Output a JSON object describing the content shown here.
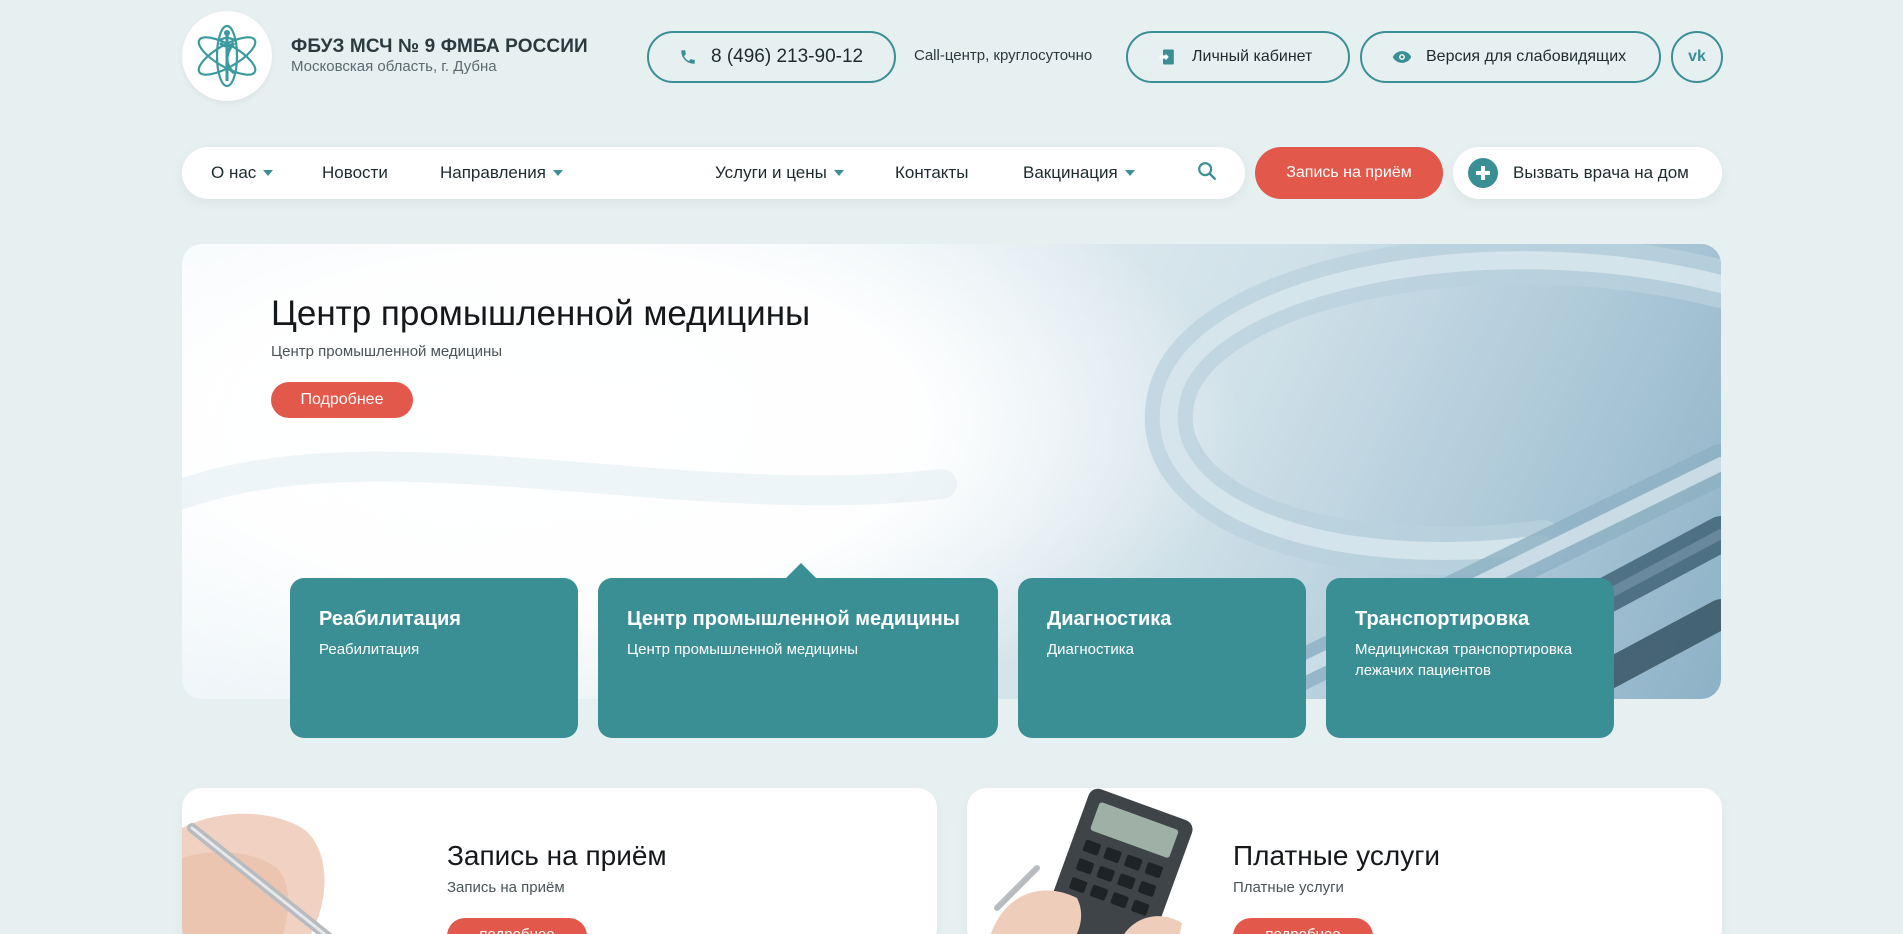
{
  "header": {
    "org_name": "ФБУЗ МСЧ № 9 ФМБА РОССИИ",
    "org_location": "Московская область, г. Дубна",
    "phone": "8 (496) 213-90-12",
    "call_center": "Call-центр, круглосуточно",
    "cabinet_label": "Личный кабинет",
    "vision_label": "Версия для слабовидящих",
    "vk_label": "vk"
  },
  "nav": {
    "items": [
      {
        "label": "О нас",
        "dropdown": true
      },
      {
        "label": "Новости",
        "dropdown": false
      },
      {
        "label": "Направления",
        "dropdown": true
      },
      {
        "label": "Услуги и цены",
        "dropdown": true
      },
      {
        "label": "Контакты",
        "dropdown": false
      },
      {
        "label": "Вакцинация",
        "dropdown": true
      }
    ],
    "appointment_label": "Запись на приём",
    "doctor_home_label": "Вызвать врача на дом"
  },
  "hero": {
    "title": "Центр промышленной медицины",
    "subtitle": "Центр промышленной медицины",
    "more_label": "Подробнее",
    "cards": [
      {
        "title": "Реабилитация",
        "subtitle": "Реабилитация"
      },
      {
        "title": "Центр промышленной медицины",
        "subtitle": "Центр промышленной медицины"
      },
      {
        "title": "Диагностика",
        "subtitle": "Диагностика"
      },
      {
        "title": "Транспортировка",
        "subtitle": "Медицинская транспортировка лежачих пациентов"
      }
    ]
  },
  "panels": [
    {
      "title": "Запись на приём",
      "subtitle": "Запись на приём",
      "button": "подробнее"
    },
    {
      "title": "Платные услуги",
      "subtitle": "Платные услуги",
      "button": "подробнее"
    }
  ],
  "colors": {
    "accent": "#3a8f95",
    "action": "#e2584a",
    "background": "#e7f0f1"
  }
}
